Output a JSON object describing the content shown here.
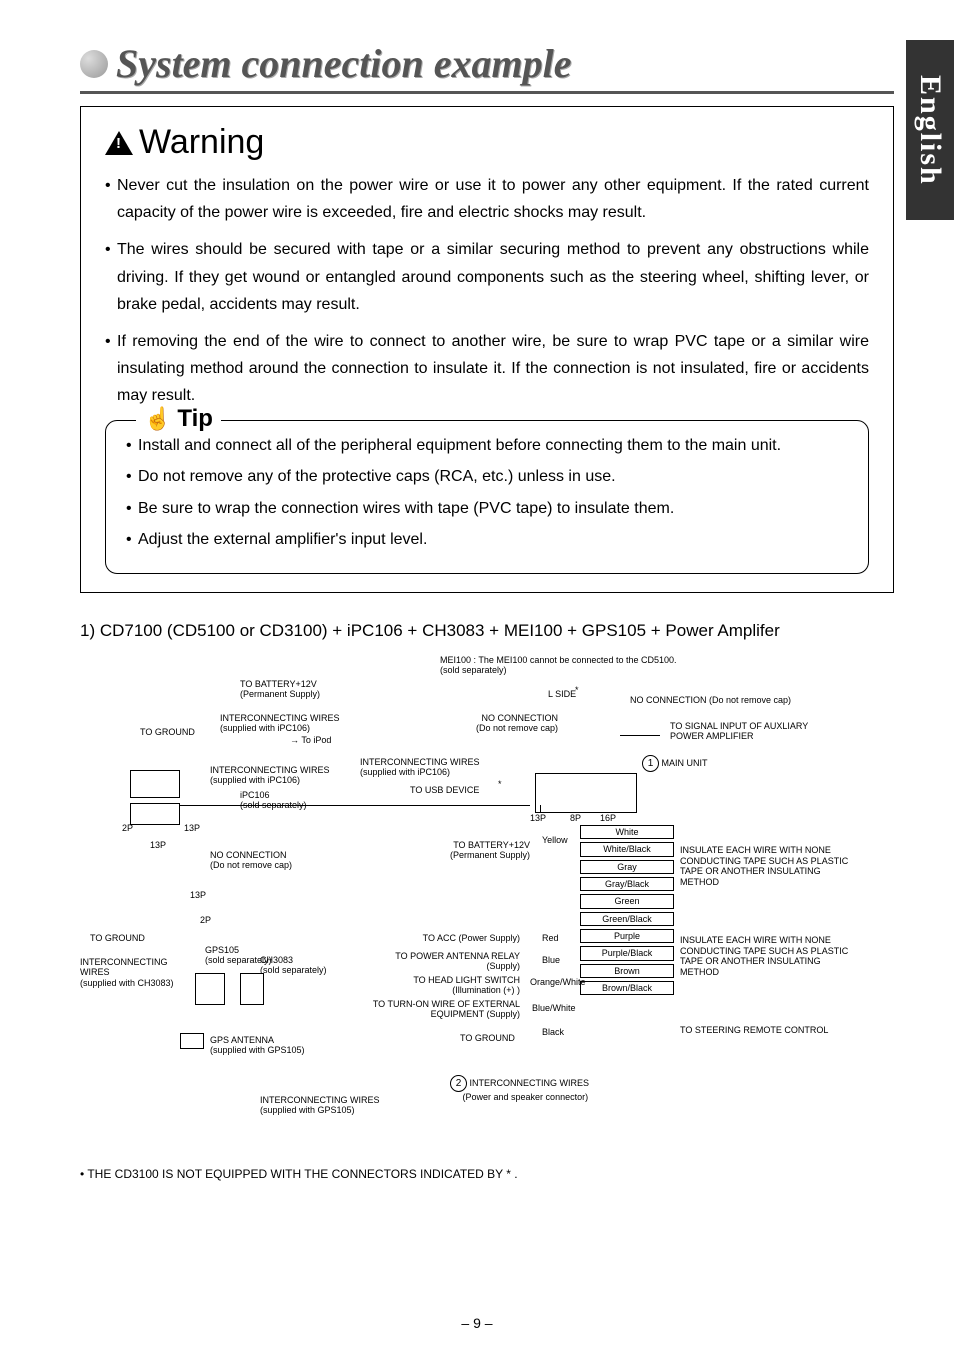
{
  "side_tab": "English",
  "title": "System connection example",
  "warning": {
    "heading": "Warning",
    "items": [
      "Never cut the insulation on the power wire or use it to power any other equipment. If the rated current capacity of the power wire is exceeded, fire and electric shocks may result.",
      "The wires should be secured with tape or a similar securing method to prevent any obstructions while driving. If they get wound or entangled around components such as the steering wheel, shifting lever, or brake pedal, accidents may result.",
      "If removing the end of the wire to connect to another wire, be sure to wrap PVC tape or a similar wire insulating method around the connection to insulate it. If the connection is not insulated, fire or accidents may result."
    ]
  },
  "tip": {
    "heading": "Tip",
    "items": [
      "Install and connect all of the peripheral equipment before connecting them to the main unit.",
      "Do not remove any of the protective caps (RCA, etc.) unless in use.",
      "Be sure to wrap the connection wires with tape (PVC tape) to insulate them.",
      "Adjust the external amplifier's input level."
    ]
  },
  "section_heading": "1) CD7100 (CD5100 or CD3100) + iPC106 + CH3083 + MEI100 + GPS105 + Power Amplifer",
  "diagram": {
    "mei100_header": "MEI100 : The MEI100 cannot be connected to the CD5100.",
    "mei100_sub": "(sold separately)",
    "to_battery": "TO BATTERY+12V",
    "perm_supply": "(Permanent Supply)",
    "interconnect_ipc106": "INTERCONNECTING WIRES",
    "ipc106_sub": "(supplied with iPC106)",
    "to_ground": "TO GROUND",
    "to_ipod": "To iPod",
    "ipc106": "iPC106",
    "sold_sep": "(sold separately)",
    "two_p": "2P",
    "thirteen_p": "13P",
    "eight_p": "8P",
    "sixteen_p": "16P",
    "no_conn": "NO CONNECTION",
    "do_not_remove": "(Do not remove cap)",
    "l_side": "L SIDE",
    "asterisk": "*",
    "no_conn_remove": "NO CONNECTION (Do not remove cap)",
    "to_signal": "TO SIGNAL INPUT OF AUXLIARY POWER AMPLIFIER",
    "main_unit": "MAIN UNIT",
    "to_usb": "TO USB DEVICE",
    "gps105": "GPS105",
    "ch3083": "CH3083",
    "interconnect_ch3083": "INTERCONNECTING WIRES",
    "ch3083_sub": "(supplied with CH3083)",
    "interconnect_wires_lbl": "INTERCONNECTING WIRES",
    "gps_ant": "GPS ANTENNA",
    "gps_ant_sub": "(supplied with GPS105)",
    "interconnect_gps": "INTERCONNECTING WIRES",
    "gps_sub": "(supplied with GPS105)",
    "to_acc": "TO ACC (Power Supply)",
    "to_pwr_ant": "TO POWER ANTENNA RELAY (Supply)",
    "to_headlight": "TO HEAD LIGHT SWITCH (Illumination (+) )",
    "to_turnon": "TO TURN-ON WIRE OF EXTERNAL EQUIPMENT (Supply)",
    "to_ground2": "TO GROUND",
    "to_battery2": "TO BATTERY+12V",
    "perm_supply2": "(Permanent Supply)",
    "wire_colors": [
      "White",
      "White/Black",
      "Gray",
      "Gray/Black",
      "Green",
      "Green/Black",
      "Purple",
      "Purple/Black",
      "Brown",
      "Brown/Black"
    ],
    "left_power_colors": [
      "Yellow",
      "Red",
      "Blue",
      "Orange/White",
      "Blue/White",
      "Black"
    ],
    "insulate_note": "INSULATE EACH WIRE WITH NONE CONDUCTING TAPE SUCH AS PLASTIC TAPE OR ANOTHER INSULATING METHOD",
    "steering": "TO STEERING REMOTE CONTROL",
    "item2_label": "INTERCONNECTING WIRES",
    "item2_sub": "(Power and speaker connector)",
    "num1": "1",
    "num2": "2"
  },
  "footnote": "THE CD3100 IS NOT EQUIPPED WITH THE CONNECTORS INDICATED BY * .",
  "page_number": "– 9 –"
}
